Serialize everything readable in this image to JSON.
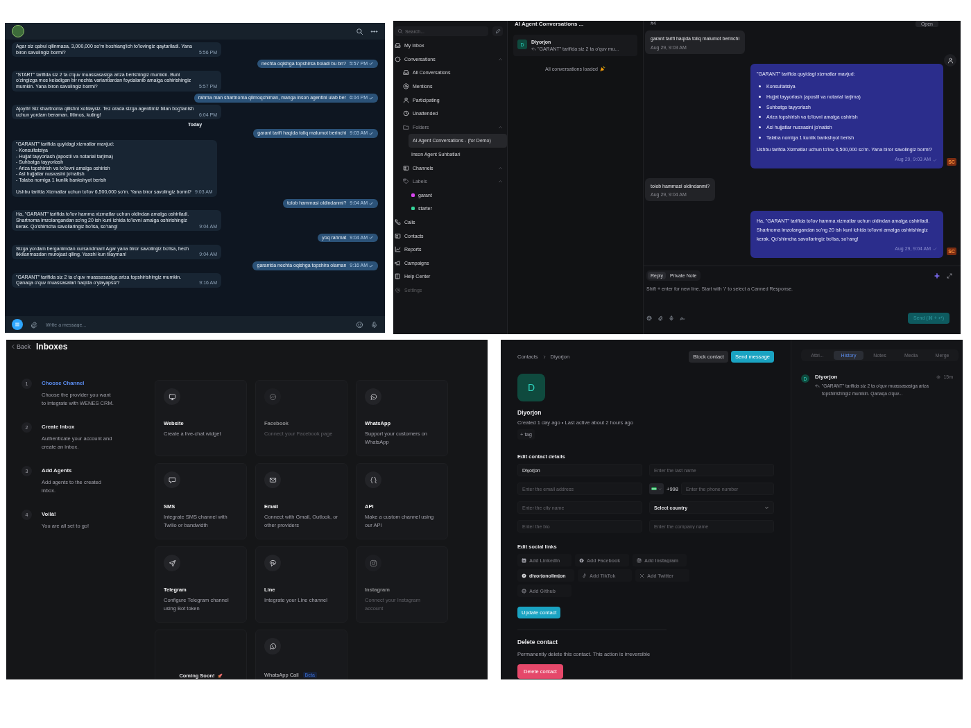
{
  "telegram_chat": {
    "messages": [
      {
        "kind": "in",
        "text": "Agar siz qabul qilinmasa, 3,000,000 so'm boshlang'ich to'lovingiz qaytariladi. Yana biron savolingiz bormi?",
        "time": "5:56 PM"
      },
      {
        "kind": "out",
        "text": "nechta oqishga topshirsa boladi bu bn?",
        "time": "5:57 PM"
      },
      {
        "kind": "in",
        "text": "\"START\" tarifida siz 2 ta o'quv muassasasiga ariza berishingiz mumkin. Buni o'zingizga mos keladigan bir nechta variantlardan foydalanib amalga oshirishingiz mumkin. Yana biron savolingiz bormi?",
        "time": "5:57 PM"
      },
      {
        "kind": "out",
        "text": "rahma man shartnoma qilmoqchiman, manga inson agentini ulab ber",
        "time": "6:04 PM"
      },
      {
        "kind": "in",
        "text": "Ajoyib! Siz shartnoma qilishni xohlaysiz. Tez orada sizga agentimiz bilan bog'lanish uchun yordam beraman. Iltimos, kuting!",
        "time": "6:04 PM"
      },
      {
        "kind": "date",
        "text": "Today"
      },
      {
        "kind": "out",
        "text": "garant tarifi haqida toliq malumot berinchi",
        "time": "9:03 AM"
      },
      {
        "kind": "in",
        "text": "\"GARANT\" tarifida quyidagi xizmatlar mavjud:\n- Konsultatsiya\n- Hujjat tayyorlash (apostil va notarial tarjima)\n- Suhbatga tayyorlash\n- Ariza topshirish va to'lovni amalga oshirish\n- Asl hujjatlar nusxasini jo'natish\n- Talaba nomiga 1 kunlik bankshyot berish\n\nUshbu tarifda Xizmatlar uchun to'lov 6,500,000 so'm. Yana biror savolingiz bormi?",
        "time": "9:03 AM"
      },
      {
        "kind": "out",
        "text": "tolob hammasi oldindanmi?",
        "time": "9:04 AM"
      },
      {
        "kind": "in",
        "text": "Ha, \"GARANT\" tarifida to'lov hamma xizmatlar uchun oldindan amalga oshiriladi. Shartnoma imzolangandan so'ng 20 ish kuni ichida to'lovni amalga oshirishingiz kerak. Qo'shimcha savollaringiz bo'lsa, so'rang!",
        "time": "9:04 AM"
      },
      {
        "kind": "out",
        "text": "yoq rahmat",
        "time": "9:04 AM"
      },
      {
        "kind": "in",
        "text": "Sizga yordam berganimdan xursandman! Agar yana biror savolingiz bo'lsa, hech ikkilanmasdan murojaat qiling. Yaxshi kun tilayman!",
        "time": "9:04 AM"
      },
      {
        "kind": "out",
        "text": "garantda nechta oqishga topshira olaman",
        "time": "9:16 AM"
      },
      {
        "kind": "in",
        "text": "\"GARANT\" tarifida siz 2 ta o'quv muassasasiga ariza topshirishingiz mumkin. Qanaqa o'quv muassasalari haqida o'ylayapsiz?",
        "time": "9:16 AM"
      }
    ],
    "composer": {
      "placeholder": "Write a message..."
    }
  },
  "helpdesk": {
    "sidebar": {
      "search": {
        "placeholder": "Search..."
      },
      "items": [
        {
          "label": "My Inbox"
        },
        {
          "label": "Conversations",
          "expanded": true,
          "children": [
            {
              "label": "All Conversations"
            },
            {
              "label": "Mentions"
            },
            {
              "label": "Participating"
            },
            {
              "label": "Unattended"
            },
            {
              "label": "Folders",
              "expanded": true,
              "children": [
                {
                  "label": "AI Agent Conversations - (for Demo)",
                  "selected": true
                },
                {
                  "label": "Inson Agent Suhbatlari",
                  "selected": false
                }
              ]
            },
            {
              "label": "Channels",
              "expanded": true
            },
            {
              "label": "Labels",
              "expanded": true,
              "children": [
                {
                  "label": "garant",
                  "color": "#d946ef"
                },
                {
                  "label": "starter",
                  "color": "#34d399"
                }
              ]
            }
          ]
        },
        {
          "label": "Calls"
        },
        {
          "label": "Contacts"
        },
        {
          "label": "Reports"
        },
        {
          "label": "Campaigns"
        },
        {
          "label": "Help Center"
        },
        {
          "label": "Settings"
        }
      ]
    },
    "conversation_list": {
      "title": "AI Agent Conversations ...",
      "items": [
        {
          "avatar": "D",
          "name": "Diyorjon",
          "preview": "\"GARANT\" tarifida siz 2 ta o'quv mu..."
        }
      ],
      "footer": "All conversations loaded"
    },
    "conversation": {
      "number": "#4",
      "status": "Open",
      "messages": [
        {
          "kind": "in",
          "text": "garant tarifi haqida toliq malumot berinchi",
          "time": "Aug 29, 9:03 AM"
        },
        {
          "kind": "out",
          "intro": "\"GARANT\" tarifida quyidagi xizmatlar mavjud:",
          "bullets": [
            "Konsultatsiya",
            "Hujjat tayyorlash (apostil va notarial tarjima)",
            "Suhbatga tayyorlash",
            "Ariza topshirish va to'lovni amalga oshirish",
            "Asl hujjatlar nusxasini jo'natish",
            "Talaba nomiga 1 kunlik bankshyot berish"
          ],
          "text": "Ushbu tarifda Xizmatlar uchun to'lov 6,500,000 so'm. Yana biror savolingiz bormi?",
          "time": "Aug 29, 9:03 AM",
          "sender": "SC"
        },
        {
          "kind": "in",
          "text": "tolob hammasi oldindanmi?",
          "time": "Aug 29, 9:04 AM"
        },
        {
          "kind": "out",
          "text": "Ha, \"GARANT\" tarifida to'lov hamma xizmatlar uchun oldindan amalga oshiriladi. Shartnoma imzolangandan so'ng 20 ish kuni ichida to'lovni amalga oshirishingiz kerak. Qo'shimcha savollaringiz bo'lsa, so'rang!",
          "time": "Aug 29, 9:04 AM",
          "sender": "SC"
        }
      ],
      "reply": {
        "tabs": [
          {
            "label": "Reply",
            "selected": true
          },
          {
            "label": "Private Note",
            "selected": false
          }
        ],
        "placeholder": "Shift + enter for new line. Start with '/' to select a Canned Response.",
        "send": "Send (⌘ + ↵)"
      }
    }
  },
  "inbox_setup": {
    "back": "Back",
    "title": "Inboxes",
    "steps": [
      {
        "number": "1",
        "title": "Choose Channel",
        "description": "Choose the provider you want to integrate with WENES CRM.",
        "active": true
      },
      {
        "number": "2",
        "title": "Create Inbox",
        "description": "Authenticate your account and create an inbox.",
        "active": false
      },
      {
        "number": "3",
        "title": "Add Agents",
        "description": "Add agents to the created inbox.",
        "active": false
      },
      {
        "number": "4",
        "title": "Voilà!",
        "description": "You are all set to go!",
        "active": false
      }
    ],
    "channels": [
      {
        "kind": "channel",
        "title": "Website",
        "description": "Create a live-chat widget",
        "disabled": false
      },
      {
        "kind": "channel",
        "title": "Facebook",
        "description": "Connect your Facebook page",
        "disabled": true
      },
      {
        "kind": "channel",
        "title": "WhatsApp",
        "description": "Support your customers on WhatsApp",
        "disabled": false
      },
      {
        "kind": "channel",
        "title": "SMS",
        "description": "Integrate SMS channel with Twilio or bandwidth",
        "disabled": false
      },
      {
        "kind": "channel",
        "title": "Email",
        "description": "Connect with Gmail, Outlook, or other providers",
        "disabled": false
      },
      {
        "kind": "channel",
        "title": "API",
        "description": "Make a custom channel using our API",
        "disabled": false
      },
      {
        "kind": "channel",
        "title": "Telegram",
        "description": "Configure Telegram channel using Bot token",
        "disabled": false
      },
      {
        "kind": "channel",
        "title": "Line",
        "description": "Integrate your Line channel",
        "disabled": false
      },
      {
        "kind": "channel",
        "title": "Instagram",
        "description": "Connect your Instagram account",
        "disabled": true
      },
      {
        "kind": "soon",
        "label": "Coming Soon!"
      },
      {
        "kind": "channel",
        "title": "WhatsApp Call",
        "badge": "Beta",
        "disabled": false
      }
    ]
  },
  "contact": {
    "breadcrumb": [
      "Contacts",
      "Diyorjon"
    ],
    "actions": {
      "block": "Block contact",
      "send": "Send message"
    },
    "avatar": "D",
    "name": "Diyorjon",
    "meta": "Created 1 day ago • Last active about 2 hours ago",
    "tag_button": "+ tag",
    "details_title": "Edit contact details",
    "fields": [
      {
        "kind": "text",
        "value": "Diyorjon"
      },
      {
        "kind": "text",
        "placeholder": "Enter the last name"
      },
      {
        "kind": "text",
        "placeholder": "Enter the email address"
      },
      {
        "kind": "phone",
        "prefix": "+998",
        "placeholder": "Enter the phone number"
      },
      {
        "kind": "text",
        "placeholder": "Enter the city name"
      },
      {
        "kind": "select",
        "value": "Select country"
      },
      {
        "kind": "text",
        "placeholder": "Enter the bio"
      },
      {
        "kind": "text",
        "placeholder": "Enter the company name"
      }
    ],
    "social_title": "Edit social links",
    "social": [
      {
        "placeholder": "Add LinkedIn"
      },
      {
        "placeholder": "Add Facebook"
      },
      {
        "placeholder": "Add Instagram"
      },
      {
        "value": "diyorjonolimjon"
      },
      {
        "placeholder": "Add TikTok"
      },
      {
        "placeholder": "Add Twitter"
      },
      {
        "placeholder": "Add Github"
      }
    ],
    "update": "Update contact",
    "delete_title": "Delete contact",
    "delete_text": "Permanently delete this contact. This action is irreversible",
    "delete_button": "Delete contact",
    "tabs": [
      {
        "label": "Attri...",
        "selected": false
      },
      {
        "label": "History",
        "selected": true
      },
      {
        "label": "Notes",
        "selected": false
      },
      {
        "label": "Media",
        "selected": false
      },
      {
        "label": "Merge",
        "selected": false
      }
    ],
    "history": [
      {
        "avatar": "D",
        "name": "Diyorjon",
        "time": "15m",
        "preview": "\"GARANT\" tarifida siz 2 ta o'quv muassasasiga ariza topshirishingiz mumkin. Qanaqa o'quv..."
      }
    ]
  }
}
